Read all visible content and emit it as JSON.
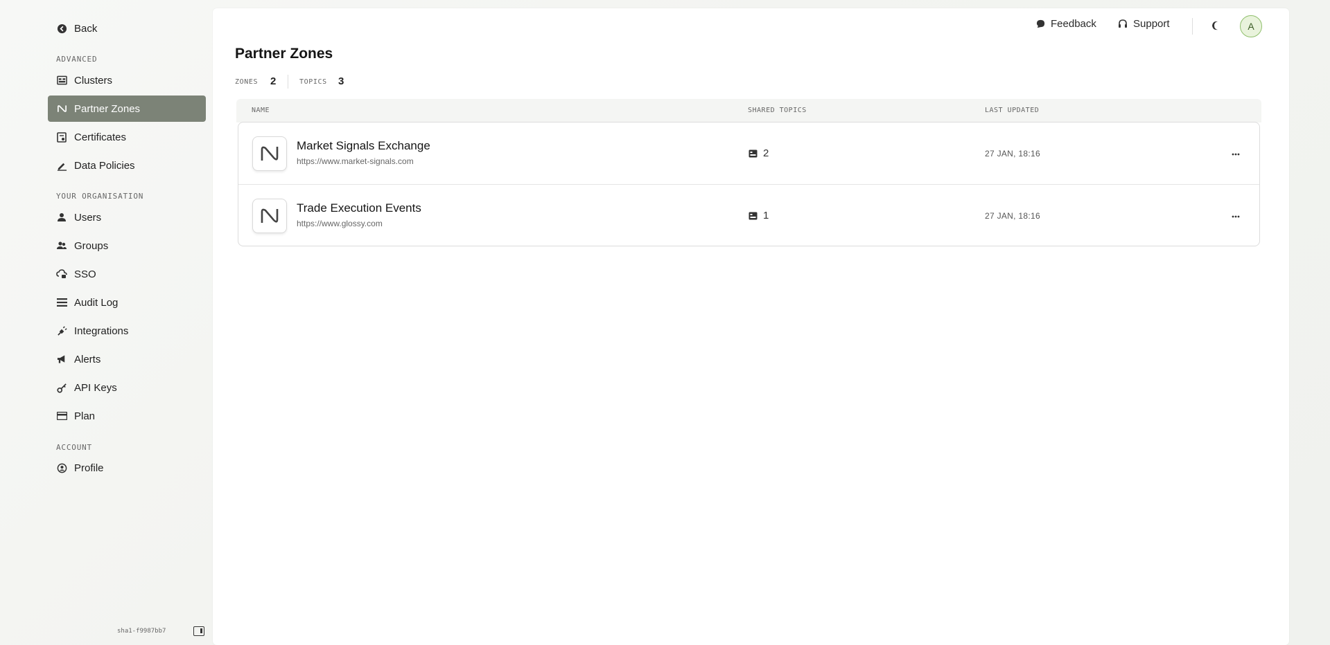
{
  "sidebar": {
    "back_label": "Back",
    "sections": {
      "advanced": "ADVANCED",
      "organisation": "YOUR ORGANISATION",
      "account": "ACCOUNT"
    },
    "items": {
      "clusters": "Clusters",
      "partner_zones": "Partner Zones",
      "certificates": "Certificates",
      "data_policies": "Data Policies",
      "users": "Users",
      "groups": "Groups",
      "sso": "SSO",
      "audit_log": "Audit Log",
      "integrations": "Integrations",
      "alerts": "Alerts",
      "api_keys": "API Keys",
      "plan": "Plan",
      "profile": "Profile"
    },
    "active_item": "partner_zones",
    "footer_hash": "sha1-f9987bb7"
  },
  "topbar": {
    "feedback_label": "Feedback",
    "support_label": "Support",
    "theme_icon": "moon-icon",
    "avatar_initial": "A"
  },
  "page": {
    "title": "Partner Zones",
    "stats": {
      "zones_label": "ZONES",
      "zones_value": "2",
      "topics_label": "TOPICS",
      "topics_value": "3"
    }
  },
  "table": {
    "columns": {
      "name": "NAME",
      "shared_topics": "SHARED TOPICS",
      "last_updated": "LAST UPDATED"
    },
    "rows": [
      {
        "name": "Market Signals Exchange",
        "url": "https://www.market-signals.com",
        "shared_topics": "2",
        "last_updated": "27 JAN, 18:16"
      },
      {
        "name": "Trade Execution Events",
        "url": "https://www.glossy.com",
        "shared_topics": "1",
        "last_updated": "27 JAN, 18:16"
      }
    ]
  },
  "colors": {
    "active_nav_bg": "#7c8377",
    "avatar_bg": "#e9f3dc",
    "avatar_border": "#8fbf6c"
  }
}
